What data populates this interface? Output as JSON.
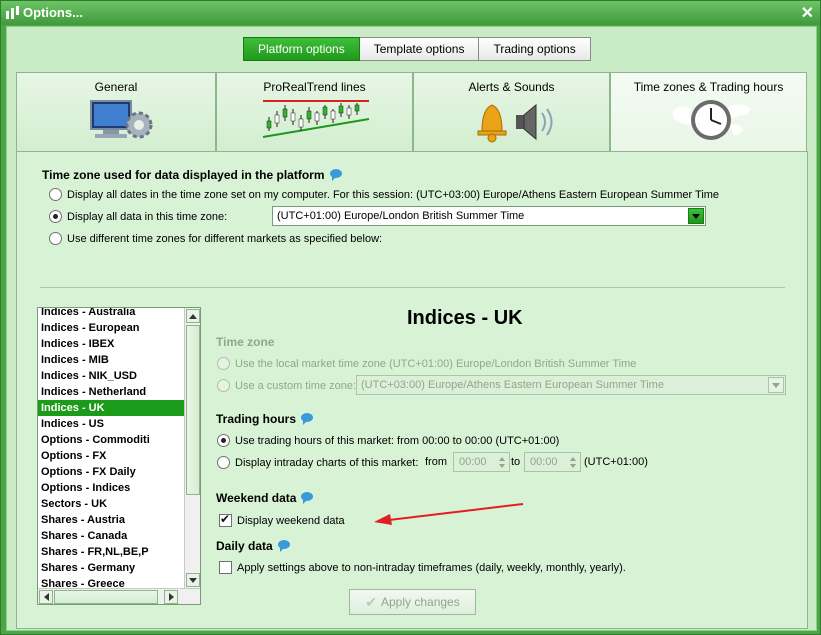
{
  "window": {
    "title": "Options..."
  },
  "top_tabs": [
    "Platform options",
    "Template options",
    "Trading options"
  ],
  "category_tabs": [
    "General",
    "ProRealTrend lines",
    "Alerts & Sounds",
    "Time zones & Trading hours"
  ],
  "timezone_section": {
    "title": "Time zone used for data displayed in the platform",
    "option_computer": "Display all dates in the time zone set on my computer. For this session:  (UTC+03:00) Europe/Athens Eastern European Summer Time",
    "option_this_zone": "Display all data in this time zone:",
    "selected_zone": "(UTC+01:00) Europe/London British Summer Time",
    "option_different": "Use different time zones for different markets as specified below:"
  },
  "markets": [
    "Indices - Australia",
    "Indices - European",
    "Indices - IBEX",
    "Indices - MIB",
    "Indices - NIK_USD",
    "Indices - Netherland",
    "Indices - UK",
    "Indices - US",
    "Options - Commoditi",
    "Options - FX",
    "Options - FX Daily",
    "Options - Indices",
    "Sectors - UK",
    "Shares - Austria",
    "Shares - Canada",
    "Shares - FR,NL,BE,P",
    "Shares - Germany",
    "Shares - Greece"
  ],
  "detail": {
    "market_title": "Indices - UK",
    "time_zone_header": "Time zone",
    "local_tz_option": "Use the local market time zone (UTC+01:00) Europe/London British Summer Time",
    "custom_tz_option": "Use a custom time zone:",
    "custom_tz_value": "(UTC+03:00) Europe/Athens Eastern European Summer Time",
    "trading_hours_header": "Trading hours",
    "use_hours_option": "Use trading hours of this market: from 00:00 to 00:00  (UTC+01:00)",
    "intraday_option": "Display intraday charts of this market:",
    "from_label": "from",
    "from_value": "00:00",
    "to_label": "to",
    "to_value": "00:00",
    "tz_suffix": "(UTC+01:00)",
    "weekend_header": "Weekend data",
    "weekend_checkbox": "Display weekend data",
    "daily_header": "Daily data",
    "daily_checkbox": "Apply settings above to non-intraday timeframes (daily, weekly, monthly, yearly)."
  },
  "apply_button": "Apply changes",
  "colors": {
    "accent": "#1c9a1a",
    "background": "#c9ecc6",
    "annotation_arrow": "#e02020"
  }
}
